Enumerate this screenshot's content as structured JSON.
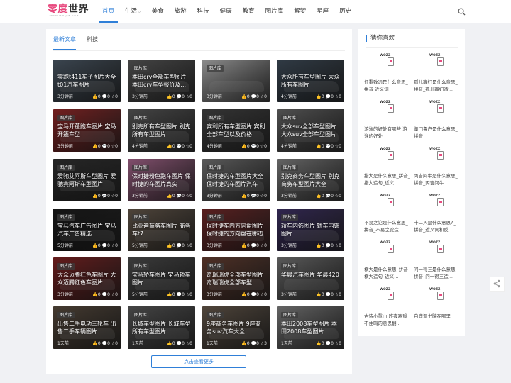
{
  "header": {
    "logo_a": "零度",
    "logo_b": "世界",
    "logo_sub": "LINGDUSHIJIE.COM",
    "nav": [
      {
        "label": "首页",
        "active": true
      },
      {
        "label": "生活",
        "dropdown": true
      },
      {
        "label": "美食"
      },
      {
        "label": "旅游"
      },
      {
        "label": "科技"
      },
      {
        "label": "健康"
      },
      {
        "label": "教育"
      },
      {
        "label": "图片库"
      },
      {
        "label": "解梦"
      },
      {
        "label": "星座"
      },
      {
        "label": "历史"
      }
    ],
    "search_icon": "search-icon"
  },
  "main": {
    "tabs": [
      {
        "label": "最新文章",
        "active": true
      },
      {
        "label": "科技"
      }
    ],
    "more_label": "点击查看更多",
    "cards": [
      {
        "badge": "",
        "title": "零跑t411车子图片大全t01汽车图片",
        "time": "3分钟前",
        "stats": "👍0 💬0 ☆0",
        "color": "#5a6a7a"
      },
      {
        "badge": "图片库",
        "title": "本田crv全部车型图片 本田crv车型报价及...",
        "time": "3分钟前",
        "stats": "👍0 💬0 ☆0",
        "color": "#6a6a6a"
      },
      {
        "badge": "图片库",
        "title": "",
        "time": "3分钟前",
        "stats": "👍0 💬0 ☆0",
        "color": "#d8d8d8"
      },
      {
        "badge": "",
        "title": "大众所有车型图片 大众所有车图片",
        "time": "4分钟前",
        "stats": "👍0 💬0 ☆0",
        "color": "#4a5a6a"
      },
      {
        "badge": "图片库",
        "title": "宝马开蓬跑车图片 宝马开篷车型",
        "time": "3分钟前",
        "stats": "👍0 💬0 ☆0",
        "color": "#b03030"
      },
      {
        "badge": "图片库",
        "title": "别克所有车型图片 别克所有车型图片",
        "time": "4分钟前",
        "stats": "👍0 💬0 ☆0",
        "color": "#6a6a6a"
      },
      {
        "badge": "图片库",
        "title": "宾利所有车型图片 宾利全部车型以及价格",
        "time": "4分钟前",
        "stats": "👍0 💬0 ☆0",
        "color": "#505050"
      },
      {
        "badge": "图片库",
        "title": "大众suv全部车型图片 大众suv全部车型图片",
        "time": "4分钟前",
        "stats": "👍0 💬0 ☆0",
        "color": "#7a7a7a"
      },
      {
        "badge": "图片库",
        "title": "爱驰艾阿斯车型图片 爱驰宾阿斯车型图片",
        "time": "",
        "stats": "👍0 💬0 ☆0",
        "color": "#3a3a3a"
      },
      {
        "badge": "图片库",
        "title": "保时捷粉色跑车图片 保时捷的车图片真实",
        "time": "3分钟前",
        "stats": "👍0 💬0 ☆0",
        "color": "#c87aa8"
      },
      {
        "badge": "图片库",
        "title": "保时捷的车型图片大全 保时捷的车图片汽车",
        "time": "3分钟前",
        "stats": "👍0 💬0 ☆0",
        "color": "#8a8a8a"
      },
      {
        "badge": "图片库",
        "title": "别克商务车型图片 别克商务车型图片大全",
        "time": "3分钟前",
        "stats": "👍0 💬0 ☆0",
        "color": "#9a9a9a"
      },
      {
        "badge": "图片库",
        "title": "宝马汽车广告图片 宝马汽车广告精选",
        "time": "5分钟前",
        "stats": "👍0 💬0 ☆0",
        "color": "#202020"
      },
      {
        "badge": "图片库",
        "title": "比亚迪商务车图片 商务车t7",
        "time": "5分钟前",
        "stats": "👍0 💬0 ☆0",
        "color": "#7a6a5a"
      },
      {
        "badge": "图片库",
        "title": "保时捷车内方向盘图片 保时捷的方向盘在哪边",
        "time": "3分钟前",
        "stats": "👍0 💬0 ☆0",
        "color": "#8a3030"
      },
      {
        "badge": "图片库",
        "title": "轿车内饰图片 轿车内饰图片",
        "time": "3分钟前",
        "stats": "👍0 💬0 ☆0",
        "color": "#4a3a7a"
      },
      {
        "badge": "图片库",
        "title": "大众迈腾红色车图片 大众迈腾红色车图片",
        "time": "3分钟前",
        "stats": "👍0 💬0 ☆0",
        "color": "#9a2a2a"
      },
      {
        "badge": "图片库",
        "title": "宝马轿车图片 宝马轿车图片",
        "time": "5分钟前",
        "stats": "👍0 💬0 ☆0",
        "color": "#5a5a5a"
      },
      {
        "badge": "图片库",
        "title": "奇瑞瑞虎全部车型图片 奇瑞瑞虎全部车型",
        "time": "3分钟前",
        "stats": "👍0 💬0 ☆0",
        "color": "#7a4a3a"
      },
      {
        "badge": "图片库",
        "title": "华晨汽车图片 华晨420",
        "time": "3分钟前",
        "stats": "👍0 💬0 ☆0",
        "color": "#8a8a8a"
      },
      {
        "badge": "图片库",
        "title": "出售二手电动三轮车 出售二手车辆图片",
        "time": "1天前",
        "stats": "👍0 💬0 ☆0",
        "color": "#6a5a4a"
      },
      {
        "badge": "图片库",
        "title": "长城车型图片 长城车型所有车型图片",
        "time": "1天前",
        "stats": "👍0 💬0 ☆0",
        "color": "#6a6a6a"
      },
      {
        "badge": "图片库",
        "title": "9座商务车图片 9座商务suv汽车大全",
        "time": "1天前",
        "stats": "👍0 💬0 ☆3",
        "color": "#7a6a5a"
      },
      {
        "badge": "图片库",
        "title": "本田2008车型图片 本田2008车型图片",
        "time": "1天前",
        "stats": "👍0 💬0 ☆0",
        "color": "#9a9a9a"
      }
    ]
  },
  "sidebar": {
    "title": "猜你喜欢",
    "thumb_text": "WOZZ",
    "items": [
      {
        "title": "任重致远是什么意思_拼音 近义词"
      },
      {
        "title": "孤儿寡妇是什么意思_拼音_孤儿寡妇造..."
      },
      {
        "title": "游泳的好处有哪些 游泳的好处"
      },
      {
        "title": "衡门鲁户是什么意思_拼音"
      },
      {
        "title": "措大是什么意思_拼音_措大造句_近义..."
      },
      {
        "title": "丙吉问牛是什么意思_拼音_丙吉问牛..."
      },
      {
        "title": "不易之论是什么意思_拼音_不易之论造..."
      },
      {
        "title": "十二入是什么意思?_拼音_近义词和反..."
      },
      {
        "title": "横大是什么意思_拼音_横大造句_近义..."
      },
      {
        "title": "问一得三是什么意思_拼音_问一得三造..."
      },
      {
        "title": "古诗小重山·昨夜寒蛩不住鸣的意思翻..."
      },
      {
        "title": "白鹿洞书院在哪里"
      }
    ]
  },
  "share_icon": "share-icon"
}
